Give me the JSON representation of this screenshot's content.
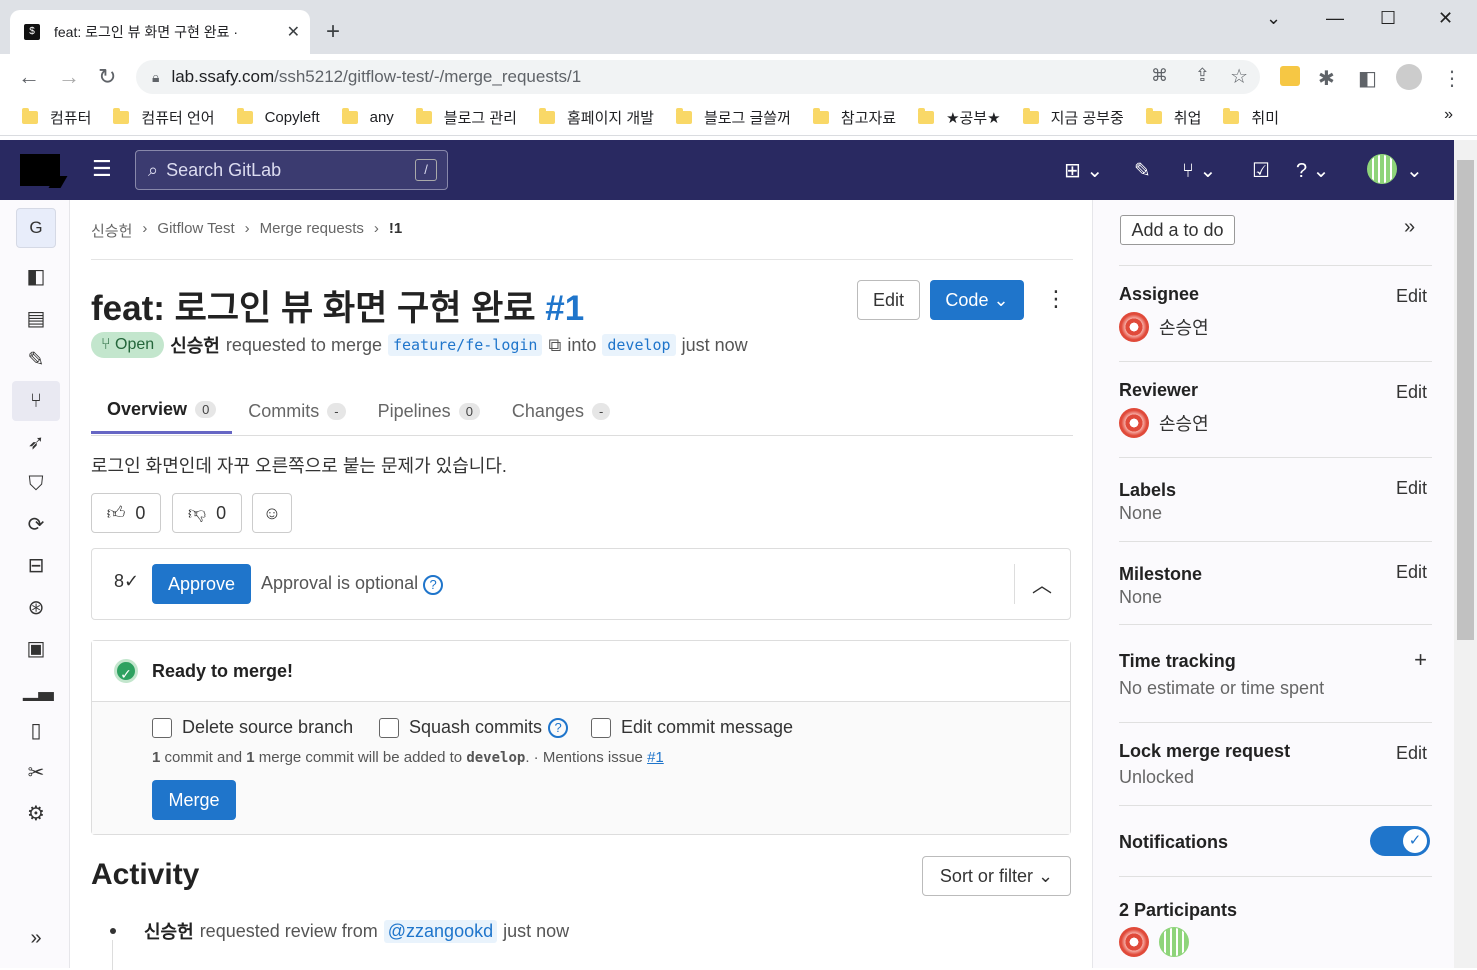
{
  "browser": {
    "tab_title": "feat: 로그인 뷰 화면 구현 완료 · ",
    "url_host": "lab.ssafy.com",
    "url_path": "/ssh5212/gitflow-test/-/merge_requests/1",
    "bookmarks": [
      "컴퓨터",
      "컴퓨터 언어",
      "Copyleft",
      "any",
      "블로그 관리",
      "홈페이지 개발",
      "블로그 글쓸꺼",
      "참고자료",
      "★공부★",
      "지금 공부중",
      "취업",
      "취미"
    ],
    "bookmarks_more": "»"
  },
  "header": {
    "search_placeholder": "Search GitLab",
    "search_shortcut": "/"
  },
  "sidebar": {
    "project_initial": "G",
    "expand_label": "»"
  },
  "breadcrumb": [
    "신승헌",
    "Gitflow Test",
    "Merge requests",
    "!1"
  ],
  "mr": {
    "title": "feat: 로그인 뷰 화면 구현 완료",
    "number": "#1",
    "edit_label": "Edit",
    "code_label": "Code",
    "status": "Open",
    "author": "신승헌",
    "requested_text": "requested to merge",
    "source_branch": "feature/fe-login",
    "into_text": "into",
    "target_branch": "develop",
    "time": "just now",
    "tabs": [
      {
        "label": "Overview",
        "count": "0"
      },
      {
        "label": "Commits",
        "count": "-"
      },
      {
        "label": "Pipelines",
        "count": "0"
      },
      {
        "label": "Changes",
        "count": "-"
      }
    ],
    "description": "로그인 화면인데 자꾸 오른쪽으로 붙는 문제가 있습니다.",
    "thumbs_up": "0",
    "thumbs_down": "0"
  },
  "approval": {
    "button": "Approve",
    "text": "Approval is optional"
  },
  "merge": {
    "status": "Ready to merge!",
    "options": [
      "Delete source branch",
      "Squash commits",
      "Edit commit message"
    ],
    "commit_info_1": "1",
    "commit_info_2": " commit and ",
    "commit_info_3": "1",
    "commit_info_4": " merge commit will be added to ",
    "commit_info_branch": "develop",
    "commit_info_5": ". · Mentions issue ",
    "commit_info_issue": "#1",
    "button": "Merge"
  },
  "activity": {
    "title": "Activity",
    "sort_label": "Sort or filter",
    "item_author": "신승헌",
    "item_text": "requested review from",
    "item_mention": "@zzangookd",
    "item_time": "just now"
  },
  "right_sidebar": {
    "todo": "Add a to do",
    "assignee_label": "Assignee",
    "assignee": "손승연",
    "reviewer_label": "Reviewer",
    "reviewer": "손승연",
    "labels_label": "Labels",
    "labels_value": "None",
    "milestone_label": "Milestone",
    "milestone_value": "None",
    "time_label": "Time tracking",
    "time_value": "No estimate or time spent",
    "lock_label": "Lock merge request",
    "lock_value": "Unlocked",
    "notifications_label": "Notifications",
    "participants_label": "2 Participants",
    "edit": "Edit"
  },
  "colors": {
    "header_bg": "#292961",
    "primary": "#1f75cb",
    "success": "#2da160"
  }
}
